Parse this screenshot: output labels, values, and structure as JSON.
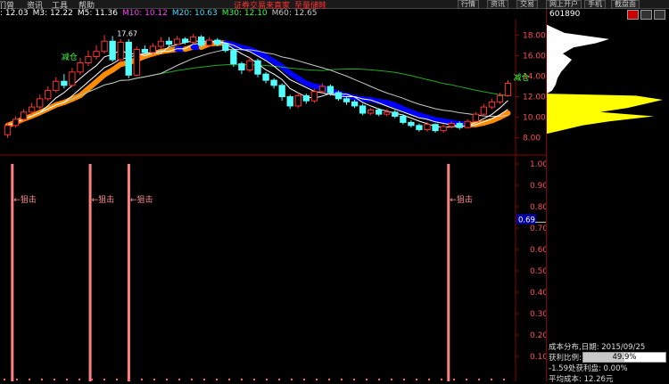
{
  "menu": {
    "items": [
      "们曾",
      "资讯",
      "工具",
      "帮助"
    ],
    "promo_left": "证券交易来直家",
    "promo_right": "至量储畦",
    "right_buttons": [
      "行情",
      "资讯",
      "交易",
      "网上开户",
      "手机",
      "截盘面"
    ]
  },
  "ma_legend": [
    {
      "text": ": 12.03",
      "color": "#ffffff"
    },
    {
      "text": "M3: 12.22",
      "color": "#ffffff"
    },
    {
      "text": "M5: 11.36",
      "color": "#ffffff"
    },
    {
      "text": "M10: 10.12",
      "color": "#ff40ff"
    },
    {
      "text": "M20: 10.63",
      "color": "#40e0ff"
    },
    {
      "text": "M30: 12.10",
      "color": "#40ff40"
    },
    {
      "text": "M60: 12.65",
      "color": "#c8c8c8"
    }
  ],
  "price_axis": {
    "labels": [
      "18.00",
      "16.00",
      "14.00",
      "12.00",
      "10.00",
      "8.00"
    ],
    "min": 6.5,
    "max": 19.5
  },
  "indicator_axis": {
    "labels": [
      "1.00",
      "0.90",
      "0.80",
      "0.70",
      "0.60",
      "0.50",
      "0.40",
      "0.30",
      "0.20",
      "0.10"
    ],
    "current": "0.69"
  },
  "annotations": {
    "reduce_label": "减仓",
    "peak_label": "17.67",
    "block_label": "←狙击"
  },
  "candles": [
    {
      "o": 8.3,
      "c": 9.2,
      "h": 9.5,
      "l": 8.0
    },
    {
      "o": 9.2,
      "c": 9.8,
      "h": 10.1,
      "l": 9.0
    },
    {
      "o": 9.8,
      "c": 10.5,
      "h": 10.8,
      "l": 9.6
    },
    {
      "o": 10.5,
      "c": 11.0,
      "h": 11.4,
      "l": 10.2
    },
    {
      "o": 11.0,
      "c": 11.8,
      "h": 12.2,
      "l": 10.8
    },
    {
      "o": 11.8,
      "c": 12.6,
      "h": 13.0,
      "l": 11.6
    },
    {
      "o": 12.6,
      "c": 13.5,
      "h": 13.9,
      "l": 12.4
    },
    {
      "o": 13.5,
      "c": 13.1,
      "h": 14.2,
      "l": 12.8
    },
    {
      "o": 13.1,
      "c": 14.4,
      "h": 14.8,
      "l": 13.0
    },
    {
      "o": 14.4,
      "c": 15.3,
      "h": 15.8,
      "l": 14.1
    },
    {
      "o": 15.3,
      "c": 15.9,
      "h": 16.5,
      "l": 15.0
    },
    {
      "o": 15.9,
      "c": 16.4,
      "h": 17.0,
      "l": 15.6
    },
    {
      "o": 16.4,
      "c": 17.4,
      "h": 18.0,
      "l": 16.2
    },
    {
      "o": 17.4,
      "c": 15.6,
      "h": 17.9,
      "l": 15.4
    },
    {
      "o": 15.6,
      "c": 17.3,
      "h": 17.6,
      "l": 15.4
    },
    {
      "o": 17.3,
      "c": 14.1,
      "h": 17.6,
      "l": 13.8
    },
    {
      "o": 14.1,
      "c": 16.6,
      "h": 16.9,
      "l": 14.0
    },
    {
      "o": 16.6,
      "c": 16.3,
      "h": 17.0,
      "l": 16.1
    },
    {
      "o": 16.3,
      "c": 16.9,
      "h": 17.2,
      "l": 16.1
    },
    {
      "o": 16.9,
      "c": 17.4,
      "h": 17.8,
      "l": 16.7
    },
    {
      "o": 17.4,
      "c": 17.1,
      "h": 17.8,
      "l": 16.8
    },
    {
      "o": 17.1,
      "c": 17.6,
      "h": 17.9,
      "l": 17.0
    },
    {
      "o": 17.6,
      "c": 17.3,
      "h": 17.8,
      "l": 17.1
    },
    {
      "o": 17.3,
      "c": 17.8,
      "h": 18.1,
      "l": 17.1
    },
    {
      "o": 17.8,
      "c": 17.0,
      "h": 18.0,
      "l": 16.8
    },
    {
      "o": 17.0,
      "c": 17.5,
      "h": 17.8,
      "l": 16.8
    },
    {
      "o": 17.5,
      "c": 17.1,
      "h": 17.7,
      "l": 16.9
    },
    {
      "o": 17.1,
      "c": 16.5,
      "h": 17.3,
      "l": 16.3
    },
    {
      "o": 16.5,
      "c": 15.2,
      "h": 16.7,
      "l": 14.9
    },
    {
      "o": 15.2,
      "c": 14.6,
      "h": 15.4,
      "l": 14.2
    },
    {
      "o": 14.6,
      "c": 15.5,
      "h": 15.9,
      "l": 14.4
    },
    {
      "o": 15.5,
      "c": 14.2,
      "h": 15.7,
      "l": 13.9
    },
    {
      "o": 14.2,
      "c": 13.6,
      "h": 14.4,
      "l": 13.3
    },
    {
      "o": 13.6,
      "c": 13.1,
      "h": 13.8,
      "l": 12.8
    },
    {
      "o": 13.1,
      "c": 12.0,
      "h": 13.3,
      "l": 11.6
    },
    {
      "o": 12.0,
      "c": 11.1,
      "h": 12.2,
      "l": 10.8
    },
    {
      "o": 11.1,
      "c": 12.1,
      "h": 12.4,
      "l": 10.9
    },
    {
      "o": 12.1,
      "c": 11.6,
      "h": 12.3,
      "l": 11.3
    },
    {
      "o": 11.6,
      "c": 12.5,
      "h": 12.8,
      "l": 11.4
    },
    {
      "o": 12.5,
      "c": 13.0,
      "h": 13.3,
      "l": 12.3
    },
    {
      "o": 13.0,
      "c": 12.4,
      "h": 13.2,
      "l": 12.1
    },
    {
      "o": 12.4,
      "c": 11.8,
      "h": 12.6,
      "l": 11.6
    },
    {
      "o": 11.8,
      "c": 11.5,
      "h": 12.0,
      "l": 11.2
    },
    {
      "o": 11.5,
      "c": 11.1,
      "h": 11.7,
      "l": 10.9
    },
    {
      "o": 11.1,
      "c": 10.4,
      "h": 11.3,
      "l": 10.2
    },
    {
      "o": 10.4,
      "c": 10.7,
      "h": 10.9,
      "l": 10.2
    },
    {
      "o": 10.7,
      "c": 10.3,
      "h": 10.9,
      "l": 10.1
    },
    {
      "o": 10.3,
      "c": 10.5,
      "h": 10.8,
      "l": 10.1
    },
    {
      "o": 10.5,
      "c": 10.1,
      "h": 10.7,
      "l": 9.9
    },
    {
      "o": 10.1,
      "c": 9.5,
      "h": 10.3,
      "l": 9.3
    },
    {
      "o": 9.5,
      "c": 9.2,
      "h": 9.7,
      "l": 9.0
    },
    {
      "o": 9.2,
      "c": 8.8,
      "h": 9.4,
      "l": 8.6
    },
    {
      "o": 8.8,
      "c": 9.3,
      "h": 9.5,
      "l": 8.6
    },
    {
      "o": 9.3,
      "c": 8.7,
      "h": 9.4,
      "l": 8.5
    },
    {
      "o": 8.7,
      "c": 9.1,
      "h": 9.3,
      "l": 8.5
    },
    {
      "o": 9.1,
      "c": 9.4,
      "h": 9.6,
      "l": 8.9
    },
    {
      "o": 9.4,
      "c": 9.0,
      "h": 9.6,
      "l": 8.8
    },
    {
      "o": 9.0,
      "c": 9.6,
      "h": 9.8,
      "l": 8.9
    },
    {
      "o": 9.6,
      "c": 10.3,
      "h": 10.5,
      "l": 9.5
    },
    {
      "o": 10.3,
      "c": 11.0,
      "h": 11.3,
      "l": 10.2
    },
    {
      "o": 11.0,
      "c": 11.5,
      "h": 11.8,
      "l": 10.8
    },
    {
      "o": 11.5,
      "c": 12.1,
      "h": 12.4,
      "l": 11.3
    },
    {
      "o": 12.1,
      "c": 13.3,
      "h": 13.6,
      "l": 12.0
    }
  ],
  "signal_bars": [
    {
      "pos": 0.023
    },
    {
      "pos": 0.174
    },
    {
      "pos": 0.249
    },
    {
      "pos": 0.869
    }
  ],
  "right_panel": {
    "stock_code": "601890",
    "cost_title": "成本分布,日期: 2015/09/25",
    "profit_ratio_label": "获利比例:",
    "profit_ratio": "49.9%",
    "profit_ratio_value": 0.499,
    "profit_at_label": "-1.59处获利盘: 0.00%",
    "avg_cost_label": "平均成本: 12.26元"
  },
  "colors": {
    "up": "#ff3232",
    "down": "#54ffff",
    "ma_white": "#ffffff",
    "ma_orange": "#ff8c00",
    "ma_blue": "#0000ff",
    "ma_green": "#22aa22",
    "signal": "#ff8080"
  }
}
